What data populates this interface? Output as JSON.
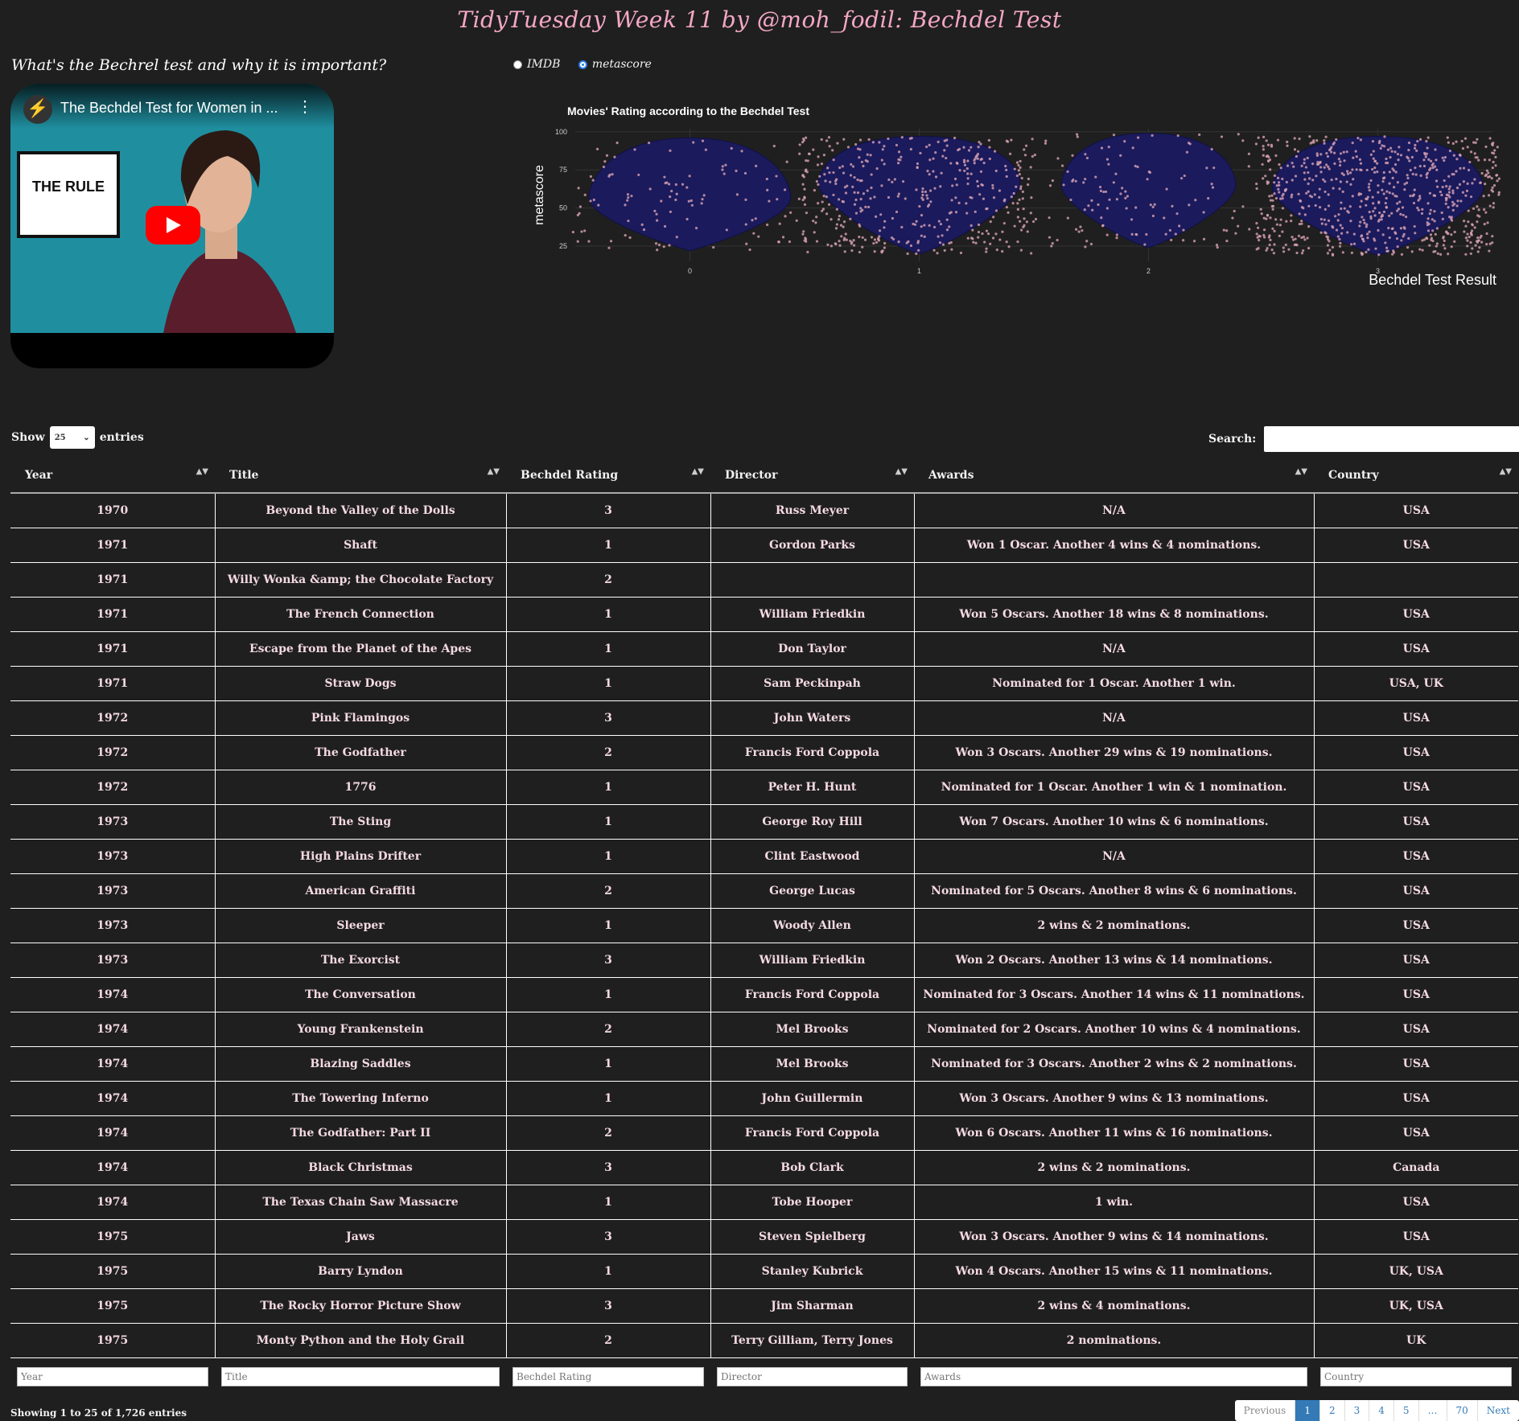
{
  "page_title": "TidyTuesday Week 11 by @moh_fodil: Bechdel Test",
  "question": "What's the Bechrel test and why it is important?",
  "video": {
    "title": "The Bechdel Test for Women in ...",
    "sign_text": "THE RULE",
    "colors": {
      "background": "#1f8fa0",
      "play": "#ff0000"
    }
  },
  "radio": {
    "options": [
      {
        "label": "IMDB",
        "selected": false
      },
      {
        "label": "metascore",
        "selected": true
      }
    ]
  },
  "chart_data": {
    "type": "violin",
    "title": "Movies' Rating according to the Bechdel Test",
    "xlabel": "Bechdel Test Result",
    "ylabel": "metascore",
    "categories": [
      "0",
      "1",
      "2",
      "3"
    ],
    "y_ticks": [
      25,
      50,
      75,
      100
    ],
    "ylim": [
      15,
      102
    ],
    "violins": [
      {
        "category": "0",
        "min": 22,
        "max": 96,
        "widest_at": 57,
        "half_width": 0.44,
        "points": 120
      },
      {
        "category": "1",
        "min": 20,
        "max": 97,
        "widest_at": 66,
        "half_width": 0.44,
        "points": 420
      },
      {
        "category": "2",
        "min": 24,
        "max": 99,
        "widest_at": 65,
        "half_width": 0.38,
        "points": 130
      },
      {
        "category": "3",
        "min": 19,
        "max": 97,
        "widest_at": 63,
        "half_width": 0.46,
        "points": 700
      }
    ],
    "colors": {
      "violin": "#1a1a5c",
      "points": "#d9a2b4",
      "grid": "#333333"
    }
  },
  "controls": {
    "show_label": "Show",
    "entries_label": "entries",
    "page_size": "25",
    "search_label": "Search:"
  },
  "table": {
    "columns": [
      "Year",
      "Title",
      "Bechdel Rating",
      "Director",
      "Awards",
      "Country"
    ],
    "rows": [
      [
        "1970",
        "Beyond the Valley of the Dolls",
        "3",
        "Russ Meyer",
        "N/A",
        "USA"
      ],
      [
        "1971",
        "Shaft",
        "1",
        "Gordon Parks",
        "Won 1 Oscar. Another 4 wins & 4 nominations.",
        "USA"
      ],
      [
        "1971",
        "Willy Wonka &amp; the Chocolate Factory",
        "2",
        "",
        "",
        ""
      ],
      [
        "1971",
        "The French Connection",
        "1",
        "William Friedkin",
        "Won 5 Oscars. Another 18 wins & 8 nominations.",
        "USA"
      ],
      [
        "1971",
        "Escape from the Planet of the Apes",
        "1",
        "Don Taylor",
        "N/A",
        "USA"
      ],
      [
        "1971",
        "Straw Dogs",
        "1",
        "Sam Peckinpah",
        "Nominated for 1 Oscar. Another 1 win.",
        "USA, UK"
      ],
      [
        "1972",
        "Pink Flamingos",
        "3",
        "John Waters",
        "N/A",
        "USA"
      ],
      [
        "1972",
        "The Godfather",
        "2",
        "Francis Ford Coppola",
        "Won 3 Oscars. Another 29 wins & 19 nominations.",
        "USA"
      ],
      [
        "1972",
        "1776",
        "1",
        "Peter H. Hunt",
        "Nominated for 1 Oscar. Another 1 win & 1 nomination.",
        "USA"
      ],
      [
        "1973",
        "The Sting",
        "1",
        "George Roy Hill",
        "Won 7 Oscars. Another 10 wins & 6 nominations.",
        "USA"
      ],
      [
        "1973",
        "High Plains Drifter",
        "1",
        "Clint Eastwood",
        "N/A",
        "USA"
      ],
      [
        "1973",
        "American Graffiti",
        "2",
        "George Lucas",
        "Nominated for 5 Oscars. Another 8 wins & 6 nominations.",
        "USA"
      ],
      [
        "1973",
        "Sleeper",
        "1",
        "Woody Allen",
        "2 wins & 2 nominations.",
        "USA"
      ],
      [
        "1973",
        "The Exorcist",
        "3",
        "William Friedkin",
        "Won 2 Oscars. Another 13 wins & 14 nominations.",
        "USA"
      ],
      [
        "1974",
        "The Conversation",
        "1",
        "Francis Ford Coppola",
        "Nominated for 3 Oscars. Another 14 wins & 11 nominations.",
        "USA"
      ],
      [
        "1974",
        "Young Frankenstein",
        "2",
        "Mel Brooks",
        "Nominated for 2 Oscars. Another 10 wins & 4 nominations.",
        "USA"
      ],
      [
        "1974",
        "Blazing Saddles",
        "1",
        "Mel Brooks",
        "Nominated for 3 Oscars. Another 2 wins & 2 nominations.",
        "USA"
      ],
      [
        "1974",
        "The Towering Inferno",
        "1",
        "John Guillermin",
        "Won 3 Oscars. Another 9 wins & 13 nominations.",
        "USA"
      ],
      [
        "1974",
        "The Godfather: Part II",
        "2",
        "Francis Ford Coppola",
        "Won 6 Oscars. Another 11 wins & 16 nominations.",
        "USA"
      ],
      [
        "1974",
        "Black Christmas",
        "3",
        "Bob Clark",
        "2 wins & 2 nominations.",
        "Canada"
      ],
      [
        "1974",
        "The Texas Chain Saw Massacre",
        "1",
        "Tobe Hooper",
        "1 win.",
        "USA"
      ],
      [
        "1975",
        "Jaws",
        "3",
        "Steven Spielberg",
        "Won 3 Oscars. Another 9 wins & 14 nominations.",
        "USA"
      ],
      [
        "1975",
        "Barry Lyndon",
        "1",
        "Stanley Kubrick",
        "Won 4 Oscars. Another 15 wins & 11 nominations.",
        "UK, USA"
      ],
      [
        "1975",
        "The Rocky Horror Picture Show",
        "3",
        "Jim Sharman",
        "2 wins & 4 nominations.",
        "UK, USA"
      ],
      [
        "1975",
        "Monty Python and the Holy Grail",
        "2",
        "Terry Gilliam, Terry Jones",
        "2 nominations.",
        "UK"
      ]
    ]
  },
  "filters": [
    "Year",
    "Title",
    "Bechdel Rating",
    "Director",
    "Awards",
    "Country"
  ],
  "info": "Showing 1 to 25 of 1,726 entries",
  "pagination": {
    "items": [
      "Previous",
      "1",
      "2",
      "3",
      "4",
      "5",
      "…",
      "70",
      "Next"
    ],
    "active": "1"
  }
}
